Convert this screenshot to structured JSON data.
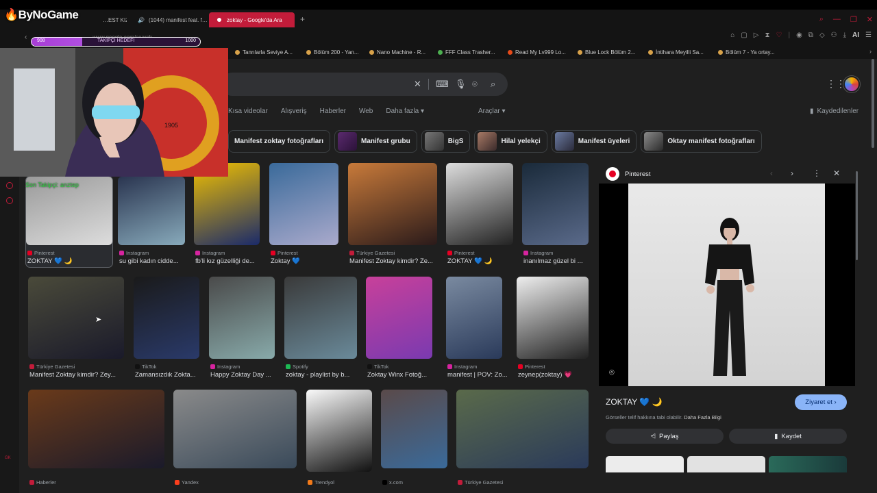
{
  "overlay": {
    "logo": "ByNoGame",
    "follow_goal": {
      "label": "TAKİPÇİ HEDEFİ",
      "current": "908",
      "target": "1000",
      "progress": 0.3
    },
    "goal_text": "Son Takipçi: anztep",
    "webcam_badge": "1905"
  },
  "browser": {
    "tabs": [
      {
        "label": "…EST KIZI",
        "active": false
      },
      {
        "label": "(1044) manifest feat. f…",
        "active": false
      },
      {
        "label": "zoktay - Google'da Ara",
        "active": true
      }
    ],
    "url": "www.google.com/search",
    "bookmarks": [
      "Tanrılarla Seviye A...",
      "Bölüm 200 - Yan...",
      "Nano Machine - R...",
      "FFF Class Trasher...",
      "Read My Lv999 Lo...",
      "Blue Lock Bölüm 2...",
      "İntihara Meyilli Sa...",
      "Bölüm 7 - Ya ortay..."
    ],
    "toolbar_ai": "AI"
  },
  "google": {
    "nav_tabs": [
      "Kısa videolar",
      "Alışveriş",
      "Haberler",
      "Web",
      "Daha fazla ▾"
    ],
    "tools": "Araçlar ▾",
    "saved": "Kaydedilenler",
    "chips": [
      "Manifest zoktay fotoğrafları",
      "Manifest grubu",
      "BigS",
      "Hilal yelekçi",
      "Manifest üyeleri",
      "Oktay manifest fotoğrafları"
    ]
  },
  "results": [
    {
      "source": "Pinterest",
      "caption": "ZOKTAY 💙 🌙"
    },
    {
      "source": "Instagram",
      "caption": "su gibi kadın cidde..."
    },
    {
      "source": "Instagram",
      "caption": "fb'li kız güzelliği de..."
    },
    {
      "source": "Pinterest",
      "caption": "Zoktay 💙"
    },
    {
      "source": "Türkiye Gazetesi",
      "caption": "Manifest Zoktay kimdir? Ze..."
    },
    {
      "source": "Pinterest",
      "caption": "ZOKTAY 💙 🌙"
    },
    {
      "source": "Instagram",
      "caption": "inanılmaz güzel bi ..."
    },
    {
      "source": "Türkiye Gazetesi",
      "caption": "Manifest Zoktay kimdir? Zey..."
    },
    {
      "source": "TikTok",
      "caption": "Zamansızdık Zokta..."
    },
    {
      "source": "Instagram",
      "caption": "Happy Zoktay Day ..."
    },
    {
      "source": "Spotify",
      "caption": "zoktay - playlist by b..."
    },
    {
      "source": "TikTok",
      "caption": "Zoktay Winx Fotoğ..."
    },
    {
      "source": "Instagram",
      "caption": "manifest | POV: Zo..."
    },
    {
      "source": "Pinterest",
      "caption": "zeynep(zoktay) 💗"
    },
    {
      "source": "Haberler",
      "caption": ""
    },
    {
      "source": "Yandex",
      "caption": ""
    },
    {
      "source": "Trendyol",
      "caption": ""
    },
    {
      "source": "x.com",
      "caption": ""
    },
    {
      "source": "Türkiye Gazetesi",
      "caption": ""
    }
  ],
  "preview": {
    "source": "Pinterest",
    "title": "ZOKTAY 💙 🌙",
    "visit": "Ziyaret et ›",
    "notice": "Görseller telif hakkına tabi olabilir.",
    "more_info": "Daha Fazla Bilgi",
    "share": "Paylaş",
    "save": "Kaydet"
  },
  "colors": {
    "accent": "#c21c3a",
    "link": "#8ab4f8",
    "bg": "#1f1f1f"
  }
}
